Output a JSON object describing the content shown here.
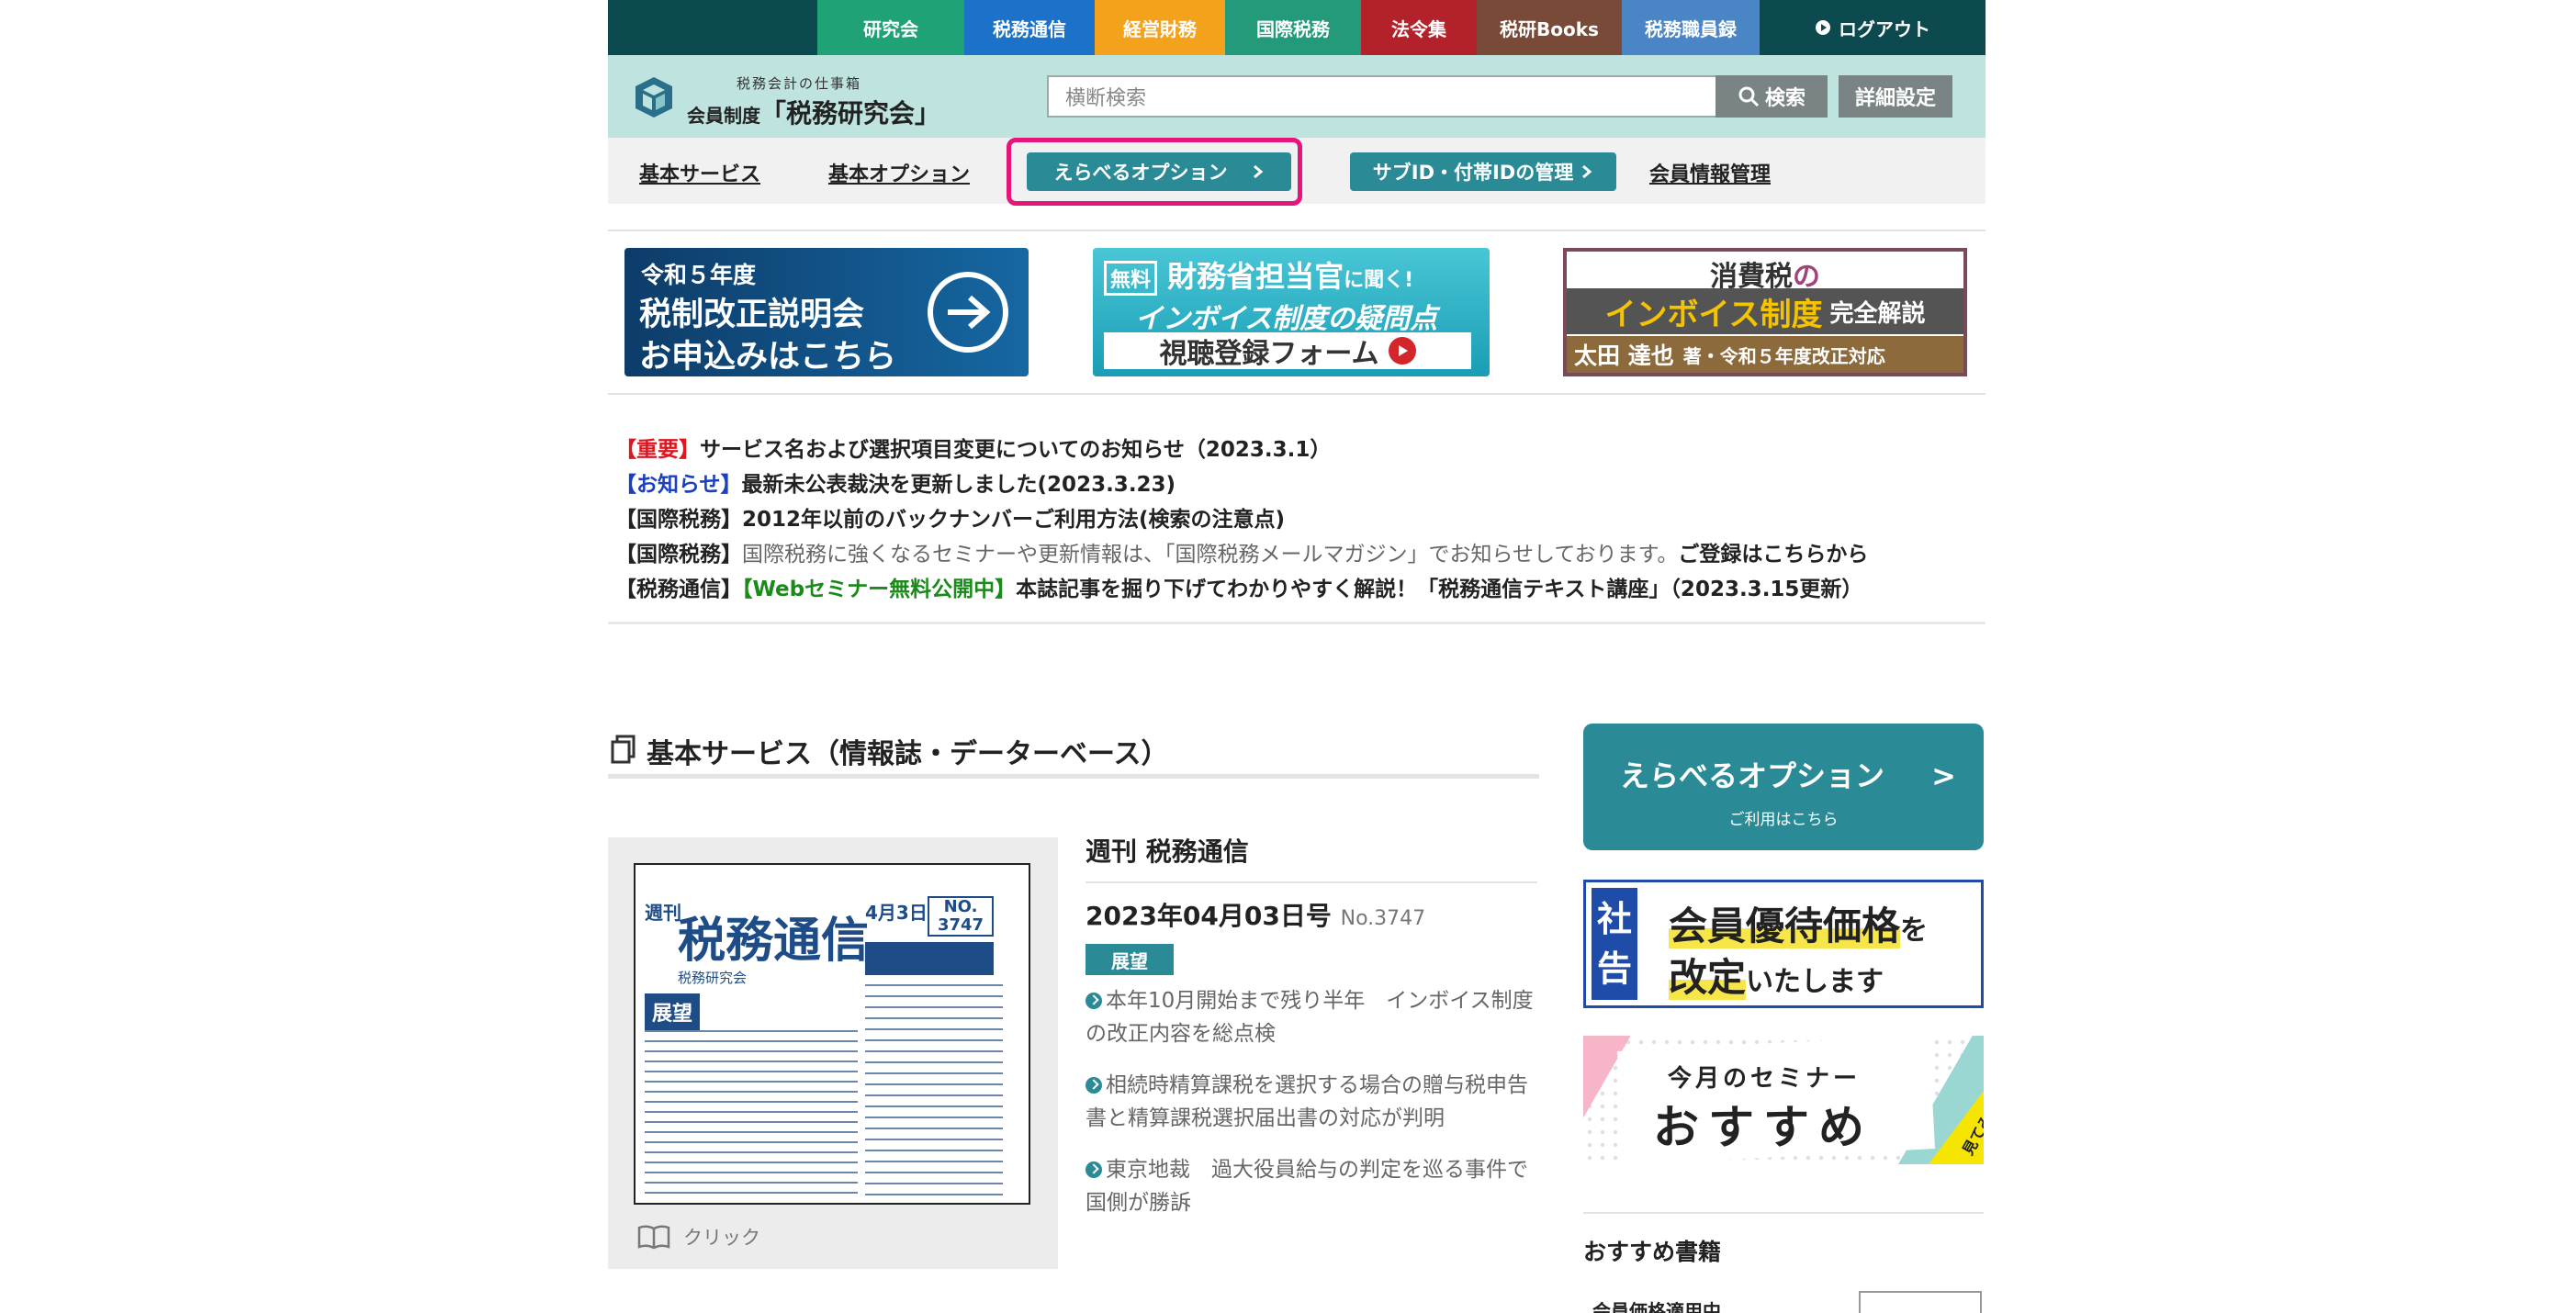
{
  "topbar": {
    "categories": [
      {
        "label": "研究会",
        "color": "#1fa376"
      },
      {
        "label": "税務通信",
        "color": "#1c72c9"
      },
      {
        "label": "経営財務",
        "color": "#f4a11b"
      },
      {
        "label": "国際税務",
        "color": "#239a7a"
      },
      {
        "label": "法令集",
        "color": "#b3222a"
      },
      {
        "label": "税研Books",
        "color": "#7a4a38"
      },
      {
        "label": "税務職員録",
        "color": "#4a86c5"
      }
    ],
    "logout": "ログアウト"
  },
  "header": {
    "logo_sub": "税務会計の仕事箱",
    "logo_prefix": "会員制度",
    "logo_name": "「税務研究会」",
    "search_placeholder": "横断検索",
    "search_button": "検索",
    "detail_button": "詳細設定"
  },
  "nav": {
    "basic_service": "基本サービス",
    "basic_option": "基本オプション",
    "selectable_option": "えらべるオプション",
    "sub_id": "サブID・付帯IDの管理",
    "member_info": "会員情報管理"
  },
  "banners": {
    "b1": {
      "line1": "令和５年度",
      "line2": "税制改正説明会",
      "line3": "お申込みはこちら"
    },
    "b2": {
      "free": "無料",
      "line1a": "財務省担当官",
      "line1b": "に聞く!",
      "line2": "インボイス制度の疑問点",
      "line3": "視聴登録フォーム"
    },
    "b3": {
      "line1a": "消費税",
      "line1b": "の",
      "line2a": "インボイス制度",
      "line2b": "完全解説",
      "line3a": "太田 達也",
      "line3b": "著・令和５年度改正対応"
    }
  },
  "news": [
    {
      "tag": "【重要】",
      "tag_color": "red",
      "text": "サービス名および選択項目変更についてのお知らせ（2023.3.1）"
    },
    {
      "tag": "【お知らせ】",
      "tag_color": "blue",
      "text": "最新未公表裁決を更新しました(2023.3.23)"
    },
    {
      "tag": "【国際税務】",
      "tag_color": "black",
      "text": "2012年以前のバックナンバーご利用方法(検索の注意点)"
    },
    {
      "tag": "【国際税務】",
      "tag_color": "black",
      "text_plain": "国際税務に強くなるセミナーや更新情報は、「国際税務メールマガジン」でお知らせしております。",
      "text": "ご登録はこちらから"
    },
    {
      "tag": "【税務通信】",
      "tag_color": "black",
      "text_green": "【Webセミナー無料公開中】",
      "text": "本誌記事を掘り下げてわかりやすく解説！「税務通信テキスト講座」（2023.3.15更新）"
    }
  ],
  "section": {
    "title": "基本サービス（情報誌・データーベース）",
    "magazine": {
      "cover_title": "税務通信",
      "cover_vert": "週刊",
      "cover_date": "4月3日",
      "cover_no": "NO. 3747",
      "cover_pub": "税務研究会",
      "cover_label": "展望",
      "click": "クリック",
      "title": "週刊 税務通信",
      "issue": "2023年04月03日号",
      "issue_no": "No.3747",
      "badge": "展望",
      "articles": [
        "本年10月開始まで残り半年　インボイス制度の改正内容を総点検",
        "相続時精算課税を選択する場合の贈与税申告書と精算課税選択届出書の対応が判明",
        "東京地裁　過大役員給与の判定を巡る事件で国側が勝訴"
      ]
    }
  },
  "sidebar": {
    "option_title": "えらべるオプション",
    "option_arrow": ">",
    "option_sub": "ご利用はこちら",
    "notice_tag1": "社",
    "notice_tag2": "告",
    "notice_l1a": "会員優待価格",
    "notice_l1b": "を",
    "notice_l2a": "改定",
    "notice_l2b": "いたします",
    "seminar_t1": "今月のセミナー",
    "seminar_t2": "おすすめ",
    "seminar_corner": "見てみる",
    "books_title": "おすすめ書籍",
    "books_peek": "会員価格適用中"
  }
}
